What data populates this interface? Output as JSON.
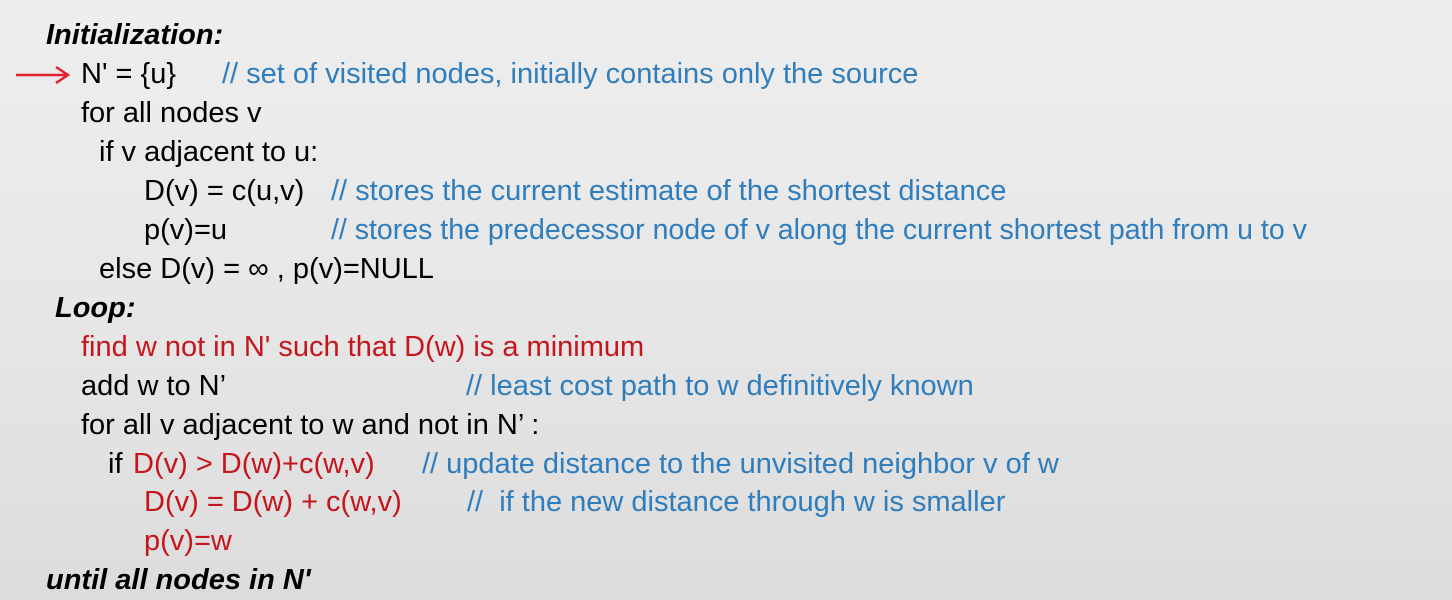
{
  "colors": {
    "code": "#000000",
    "comment": "#2f7dbd",
    "highlight": "#c4161c",
    "arrow": "#e0202a"
  },
  "initialization": {
    "heading": "Initialization:",
    "arrow_icon": "right-arrow",
    "line1_code": "N' = {u}",
    "line1_comment": "// set of visited nodes, initially contains only the source",
    "line2_code": "for all nodes v",
    "line3_code": "if v adjacent to u:",
    "line4_code": "D(v) = c(u,v)",
    "line4_comment": "// stores the current estimate of the shortest distance",
    "line5_code": "p(v)=u",
    "line5_comment": "// stores the predecessor node of v along the current shortest path from u to v",
    "line6_code": "else D(v) = ∞ , p(v)=NULL"
  },
  "loop": {
    "heading": "Loop:",
    "line1_code": "find w not in N' such that D(w) is a minimum",
    "line2_code": "add w to N’",
    "line2_comment": "// least cost path to w definitively known",
    "line3_code": "for all v adjacent to w and not in N’ :",
    "line4_if": "if",
    "line4_condition": "D(v) > D(w)+c(w,v)",
    "line4_comment": "// update distance to the unvisited neighbor v of w",
    "line5_code": "D(v) = D(w) + c(w,v)",
    "line5_comment": "//  if the new distance through w is smaller",
    "line6_code": "p(v)=w"
  },
  "footer": {
    "until": "until all nodes in N'"
  }
}
